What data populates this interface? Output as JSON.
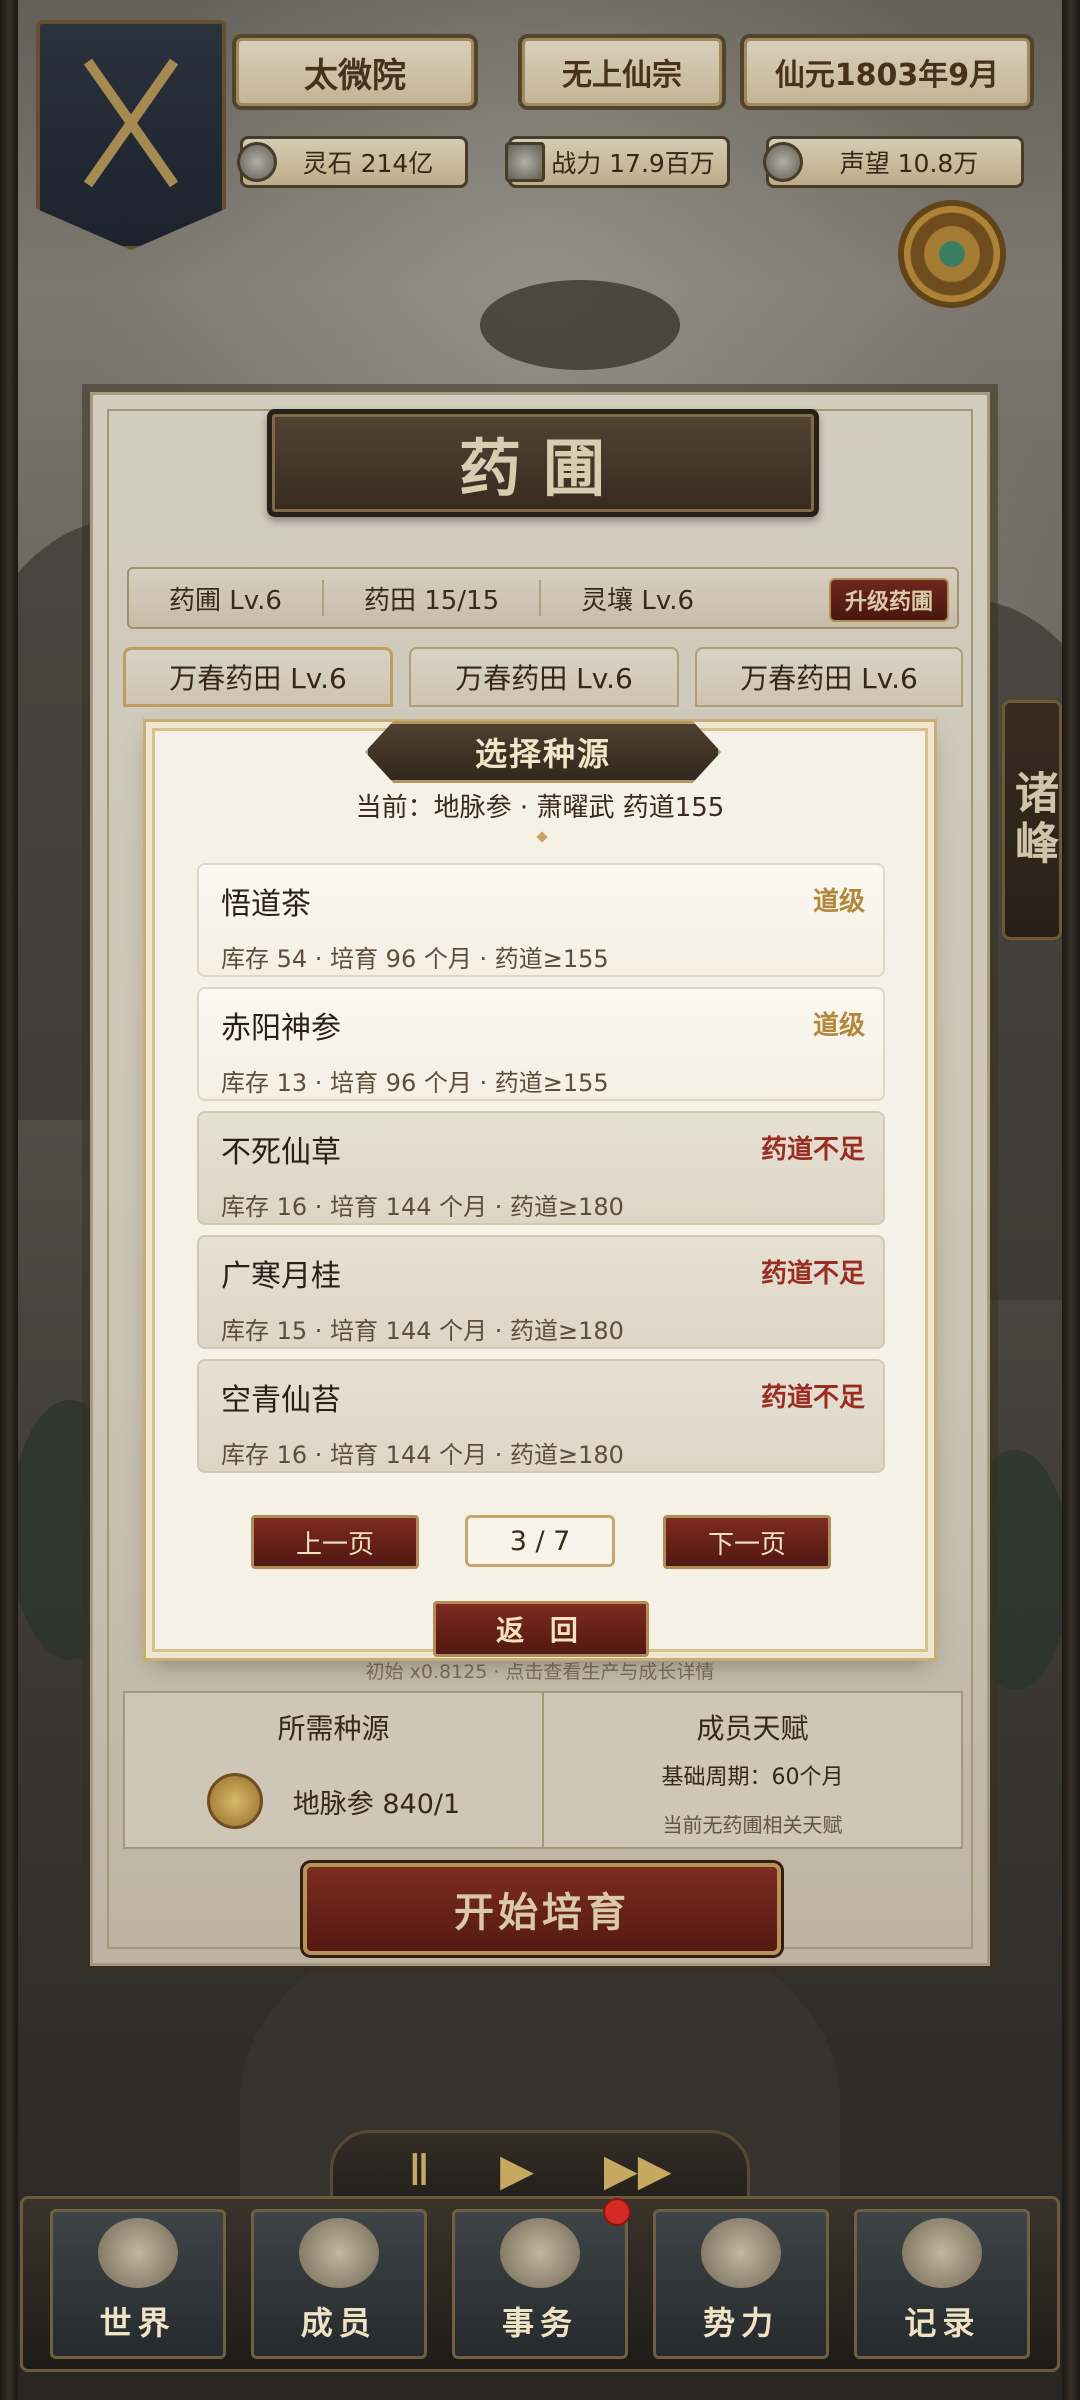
{
  "header": {
    "hall_name": "太微院",
    "sect_name": "无上仙宗",
    "date": "仙元1803年9月",
    "stats": {
      "spirit_stone": "灵石 214亿",
      "power": "战力 17.9百万",
      "prestige": "声望 10.8万"
    }
  },
  "side_tab": {
    "label": "诸峰"
  },
  "garden": {
    "title": "药圃",
    "info": {
      "level": "药圃  Lv.6",
      "fields": "药田  15/15",
      "soil": "灵壤  Lv.6",
      "upgrade_label": "升级药圃"
    },
    "field_tabs": [
      {
        "label": "万春药田  Lv.6"
      },
      {
        "label": "万春药田  Lv.6"
      },
      {
        "label": "万春药田  Lv.6"
      }
    ],
    "under_text": "初始 x0.8125 · 点击查看生产与成长详情",
    "required_seed": {
      "title": "所需种源",
      "value": "地脉参  840/1"
    },
    "talent": {
      "title": "成员天赋",
      "base_cycle": "基础周期：60个月",
      "note": "当前无药圃相关天赋"
    },
    "start_label": "开始培育"
  },
  "modal": {
    "title": "选择种源",
    "current": "当前：地脉参  ·  萧曜武 药道155",
    "items": [
      {
        "name": "悟道茶",
        "meta": "库存 54  ·  培育 96 个月  ·  药道≥155",
        "badge": "道级",
        "status": "ok"
      },
      {
        "name": "赤阳神参",
        "meta": "库存 13  ·  培育 96 个月  ·  药道≥155",
        "badge": "道级",
        "status": "ok"
      },
      {
        "name": "不死仙草",
        "meta": "库存 16  ·  培育 144 个月  ·  药道≥180",
        "badge": "药道不足",
        "status": "no"
      },
      {
        "name": "广寒月桂",
        "meta": "库存 15  ·  培育 144 个月  ·  药道≥180",
        "badge": "药道不足",
        "status": "no"
      },
      {
        "name": "空青仙苔",
        "meta": "库存 16  ·  培育 144 个月  ·  药道≥180",
        "badge": "药道不足",
        "status": "no"
      }
    ],
    "prev_label": "上一页",
    "page_indicator": "3 / 7",
    "next_label": "下一页",
    "back_label": "返 回"
  },
  "playback": {
    "pause": "Ⅱ",
    "play": "▶",
    "fast": "▶▶"
  },
  "nav": {
    "items": [
      {
        "label": "世界"
      },
      {
        "label": "成员"
      },
      {
        "label": "事务"
      },
      {
        "label": "势力"
      },
      {
        "label": "记录"
      }
    ]
  },
  "colors": {
    "accent_red": "#7a2a1f",
    "gold": "#c9a565",
    "insufficient_red": "#9a2d22",
    "dao_gold": "#b3883c"
  }
}
